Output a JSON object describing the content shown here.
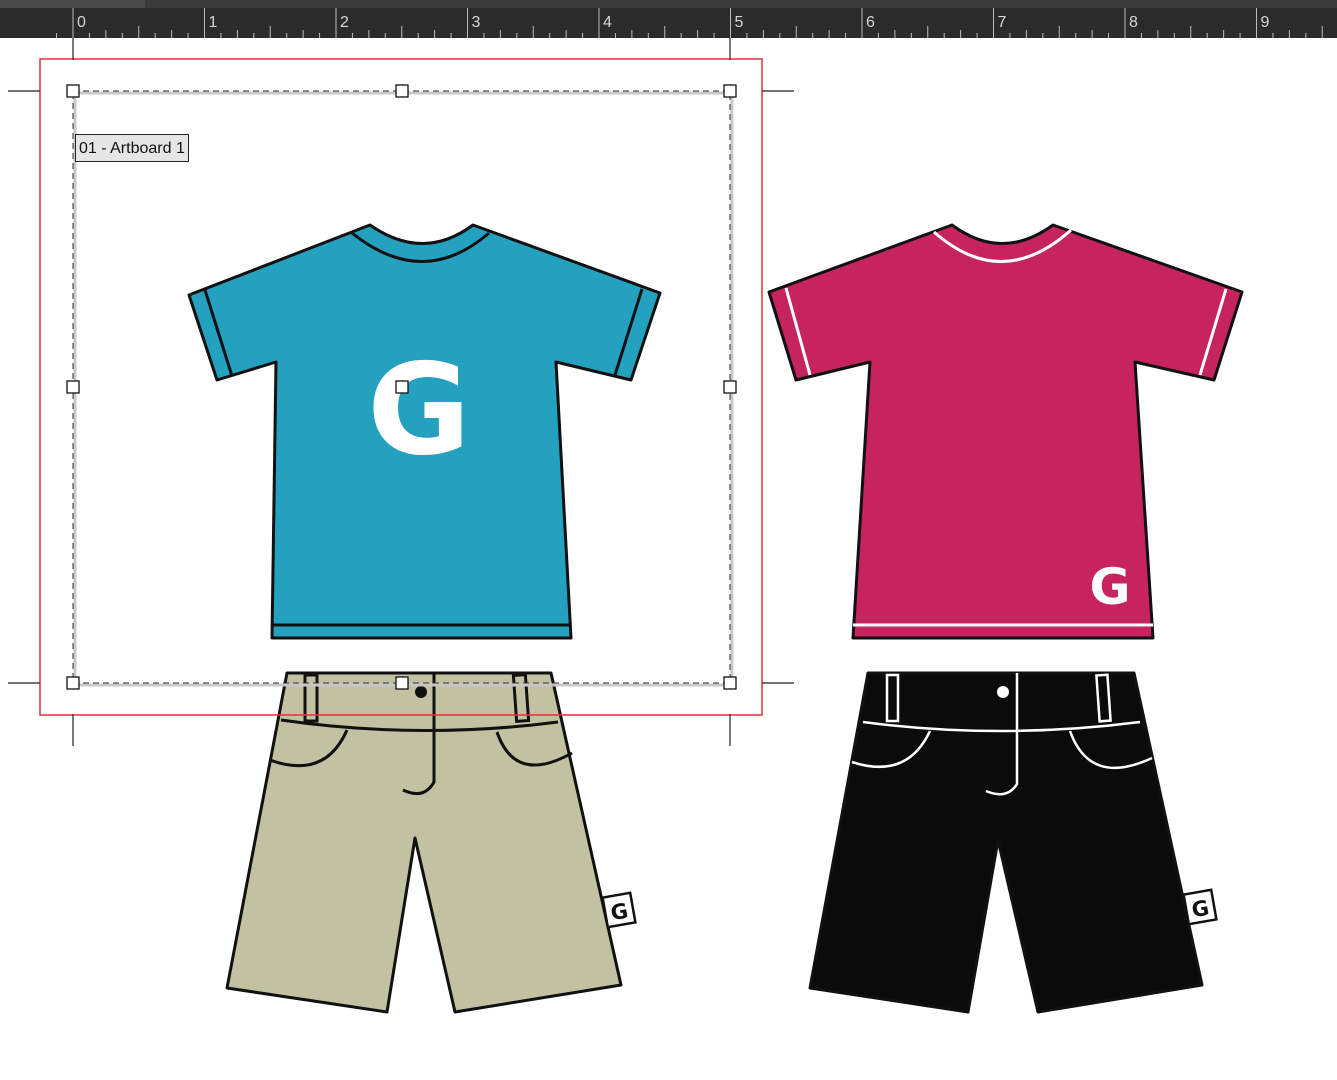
{
  "ruler": {
    "labels": [
      "0",
      "1",
      "2",
      "3",
      "4",
      "5",
      "6",
      "7",
      "8",
      "9"
    ]
  },
  "artboard": {
    "label": "01 - Artboard 1",
    "border_color": "#e0333a"
  },
  "garments": {
    "blue_tee": {
      "color": "#25a1c0",
      "logo": "G"
    },
    "pink_tee": {
      "color": "#c6245e",
      "logo": "G"
    },
    "khaki_shorts": {
      "color": "#c2c2a3",
      "tag": "G"
    },
    "black_shorts": {
      "color": "#0b0b0b",
      "tag": "G"
    }
  }
}
